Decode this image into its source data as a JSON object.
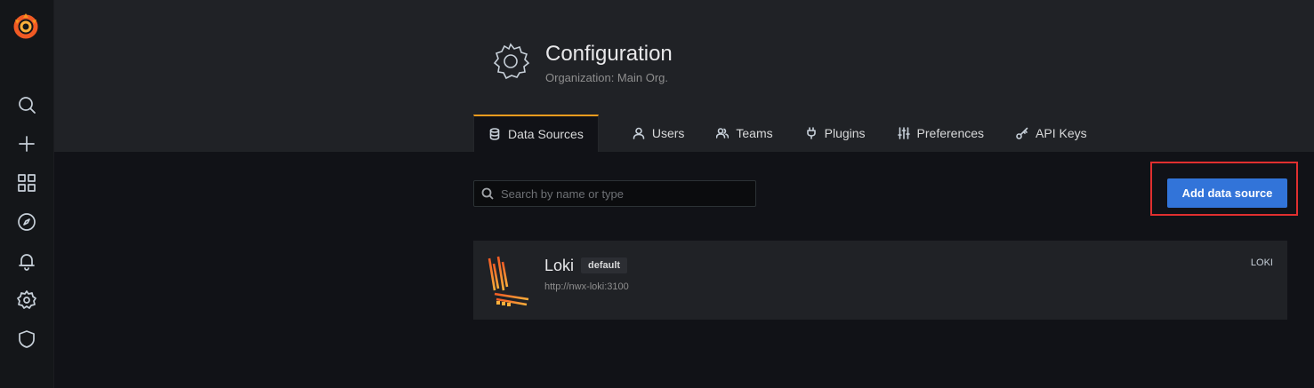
{
  "sidebar": {
    "logo": "grafana-logo",
    "items": [
      {
        "icon": "search-icon"
      },
      {
        "icon": "plus-icon"
      },
      {
        "icon": "dashboards-icon"
      },
      {
        "icon": "explore-compass-icon"
      },
      {
        "icon": "bell-icon"
      },
      {
        "icon": "gear-icon"
      },
      {
        "icon": "shield-icon"
      }
    ]
  },
  "header": {
    "title": "Configuration",
    "subtitle": "Organization: Main Org.",
    "icon": "gear-icon"
  },
  "tabs": [
    {
      "label": "Data Sources",
      "icon": "database-icon",
      "active": true
    },
    {
      "label": "Users",
      "icon": "user-icon"
    },
    {
      "label": "Teams",
      "icon": "users-icon"
    },
    {
      "label": "Plugins",
      "icon": "plug-icon"
    },
    {
      "label": "Preferences",
      "icon": "sliders-icon"
    },
    {
      "label": "API Keys",
      "icon": "key-icon"
    }
  ],
  "search": {
    "placeholder": "Search by name or type",
    "value": ""
  },
  "add_button": {
    "label": "Add data source"
  },
  "datasources": [
    {
      "name": "Loki",
      "badge": "default",
      "url": "http://nwx-loki:3100",
      "type": "LOKI",
      "icon": "loki-logo"
    }
  ],
  "colors": {
    "accent": "#f59c1e",
    "primary_button": "#3274d9",
    "highlight_box": "#e02f2f"
  }
}
